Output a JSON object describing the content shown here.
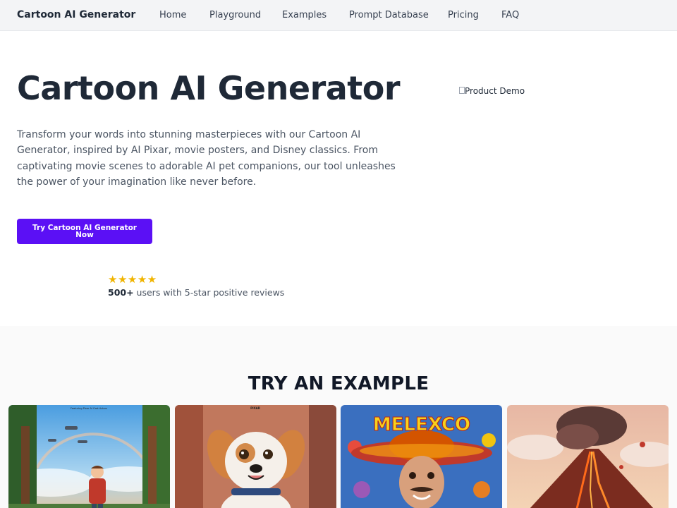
{
  "nav": {
    "brand": "Cartoon AI Generator",
    "links": [
      "Home",
      "Playground",
      "Examples",
      "Prompt Database",
      "Pricing",
      "FAQ"
    ]
  },
  "hero": {
    "title": "Cartoon AI Generator",
    "description": "Transform your words into stunning masterpieces with our Cartoon AI Generator, inspired by AI Pixar, movie posters, and Disney classics. From captivating movie scenes to adorable AI pet companions, our tool unleashes the power of your imagination like never before.",
    "cta_label": "Try Cartoon AI Generator Now",
    "demo_alt": "Product Demo"
  },
  "reviews": {
    "stars": "★★★★★",
    "rating": 5,
    "count": "500+",
    "text": " users with 5-star positive reviews"
  },
  "examples": {
    "title": "TRY AN EXAMPLE",
    "cards": [
      {
        "caption_tiny": "Featuring Pixar AI Cast Actors"
      },
      {
        "caption_tiny": "PIXAR"
      },
      {
        "caption_tiny": "MELEXCO"
      },
      {
        "caption_tiny": ""
      }
    ]
  },
  "colors": {
    "accent": "#5b10f5",
    "star": "#f0b400",
    "nav_bg": "#f3f4f6"
  }
}
